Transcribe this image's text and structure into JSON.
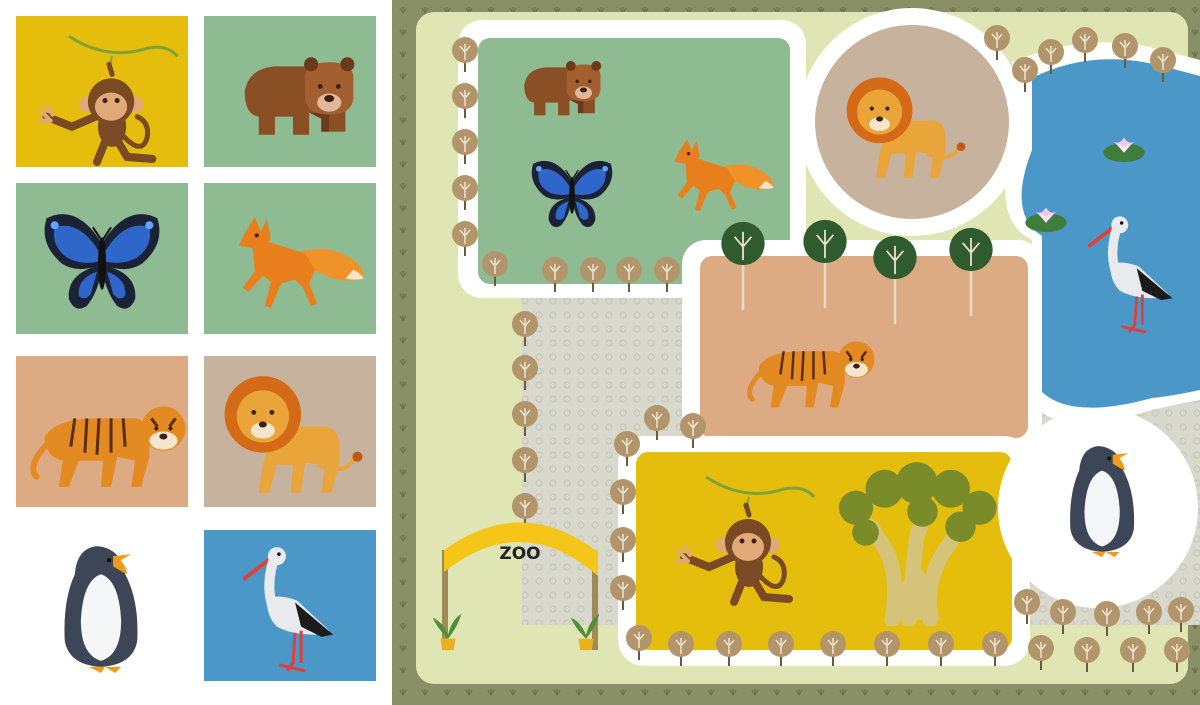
{
  "palette": {
    "monkey_tile": "#e5bd0c",
    "bear_tile": "#8fbb92",
    "butterfly_tile": "#8fbb92",
    "fox_tile": "#8fbb92",
    "tiger_tile": "#dcab84",
    "lion_tile": "#c7b29e",
    "penguin_tile": "#ffffff",
    "stork_tile": "#4b97c8",
    "map_border": "#8a9066",
    "map_ground": "#dfe6b3",
    "path": "#d5d4c8",
    "pond": "#4b97c8"
  },
  "tray": {
    "tiles": [
      {
        "animal": "monkey",
        "icon": "monkey-icon"
      },
      {
        "animal": "bear",
        "icon": "bear-icon"
      },
      {
        "animal": "butterfly",
        "icon": "butterfly-icon"
      },
      {
        "animal": "fox",
        "icon": "fox-icon"
      },
      {
        "animal": "tiger",
        "icon": "tiger-icon"
      },
      {
        "animal": "lion",
        "icon": "lion-icon"
      },
      {
        "animal": "penguin",
        "icon": "penguin-icon"
      },
      {
        "animal": "stork",
        "icon": "stork-icon"
      }
    ]
  },
  "map": {
    "gate_label": "ZOO",
    "enclosures": [
      {
        "zone": "forest",
        "animals": [
          "bear",
          "butterfly",
          "fox"
        ]
      },
      {
        "zone": "savanna-circle",
        "animals": [
          "lion"
        ]
      },
      {
        "zone": "pond",
        "animals": [
          "stork"
        ]
      },
      {
        "zone": "striped-cat-yard",
        "animals": [
          "tiger"
        ]
      },
      {
        "zone": "jungle",
        "animals": [
          "monkey"
        ]
      },
      {
        "zone": "ice",
        "animals": [
          "penguin"
        ]
      }
    ]
  }
}
